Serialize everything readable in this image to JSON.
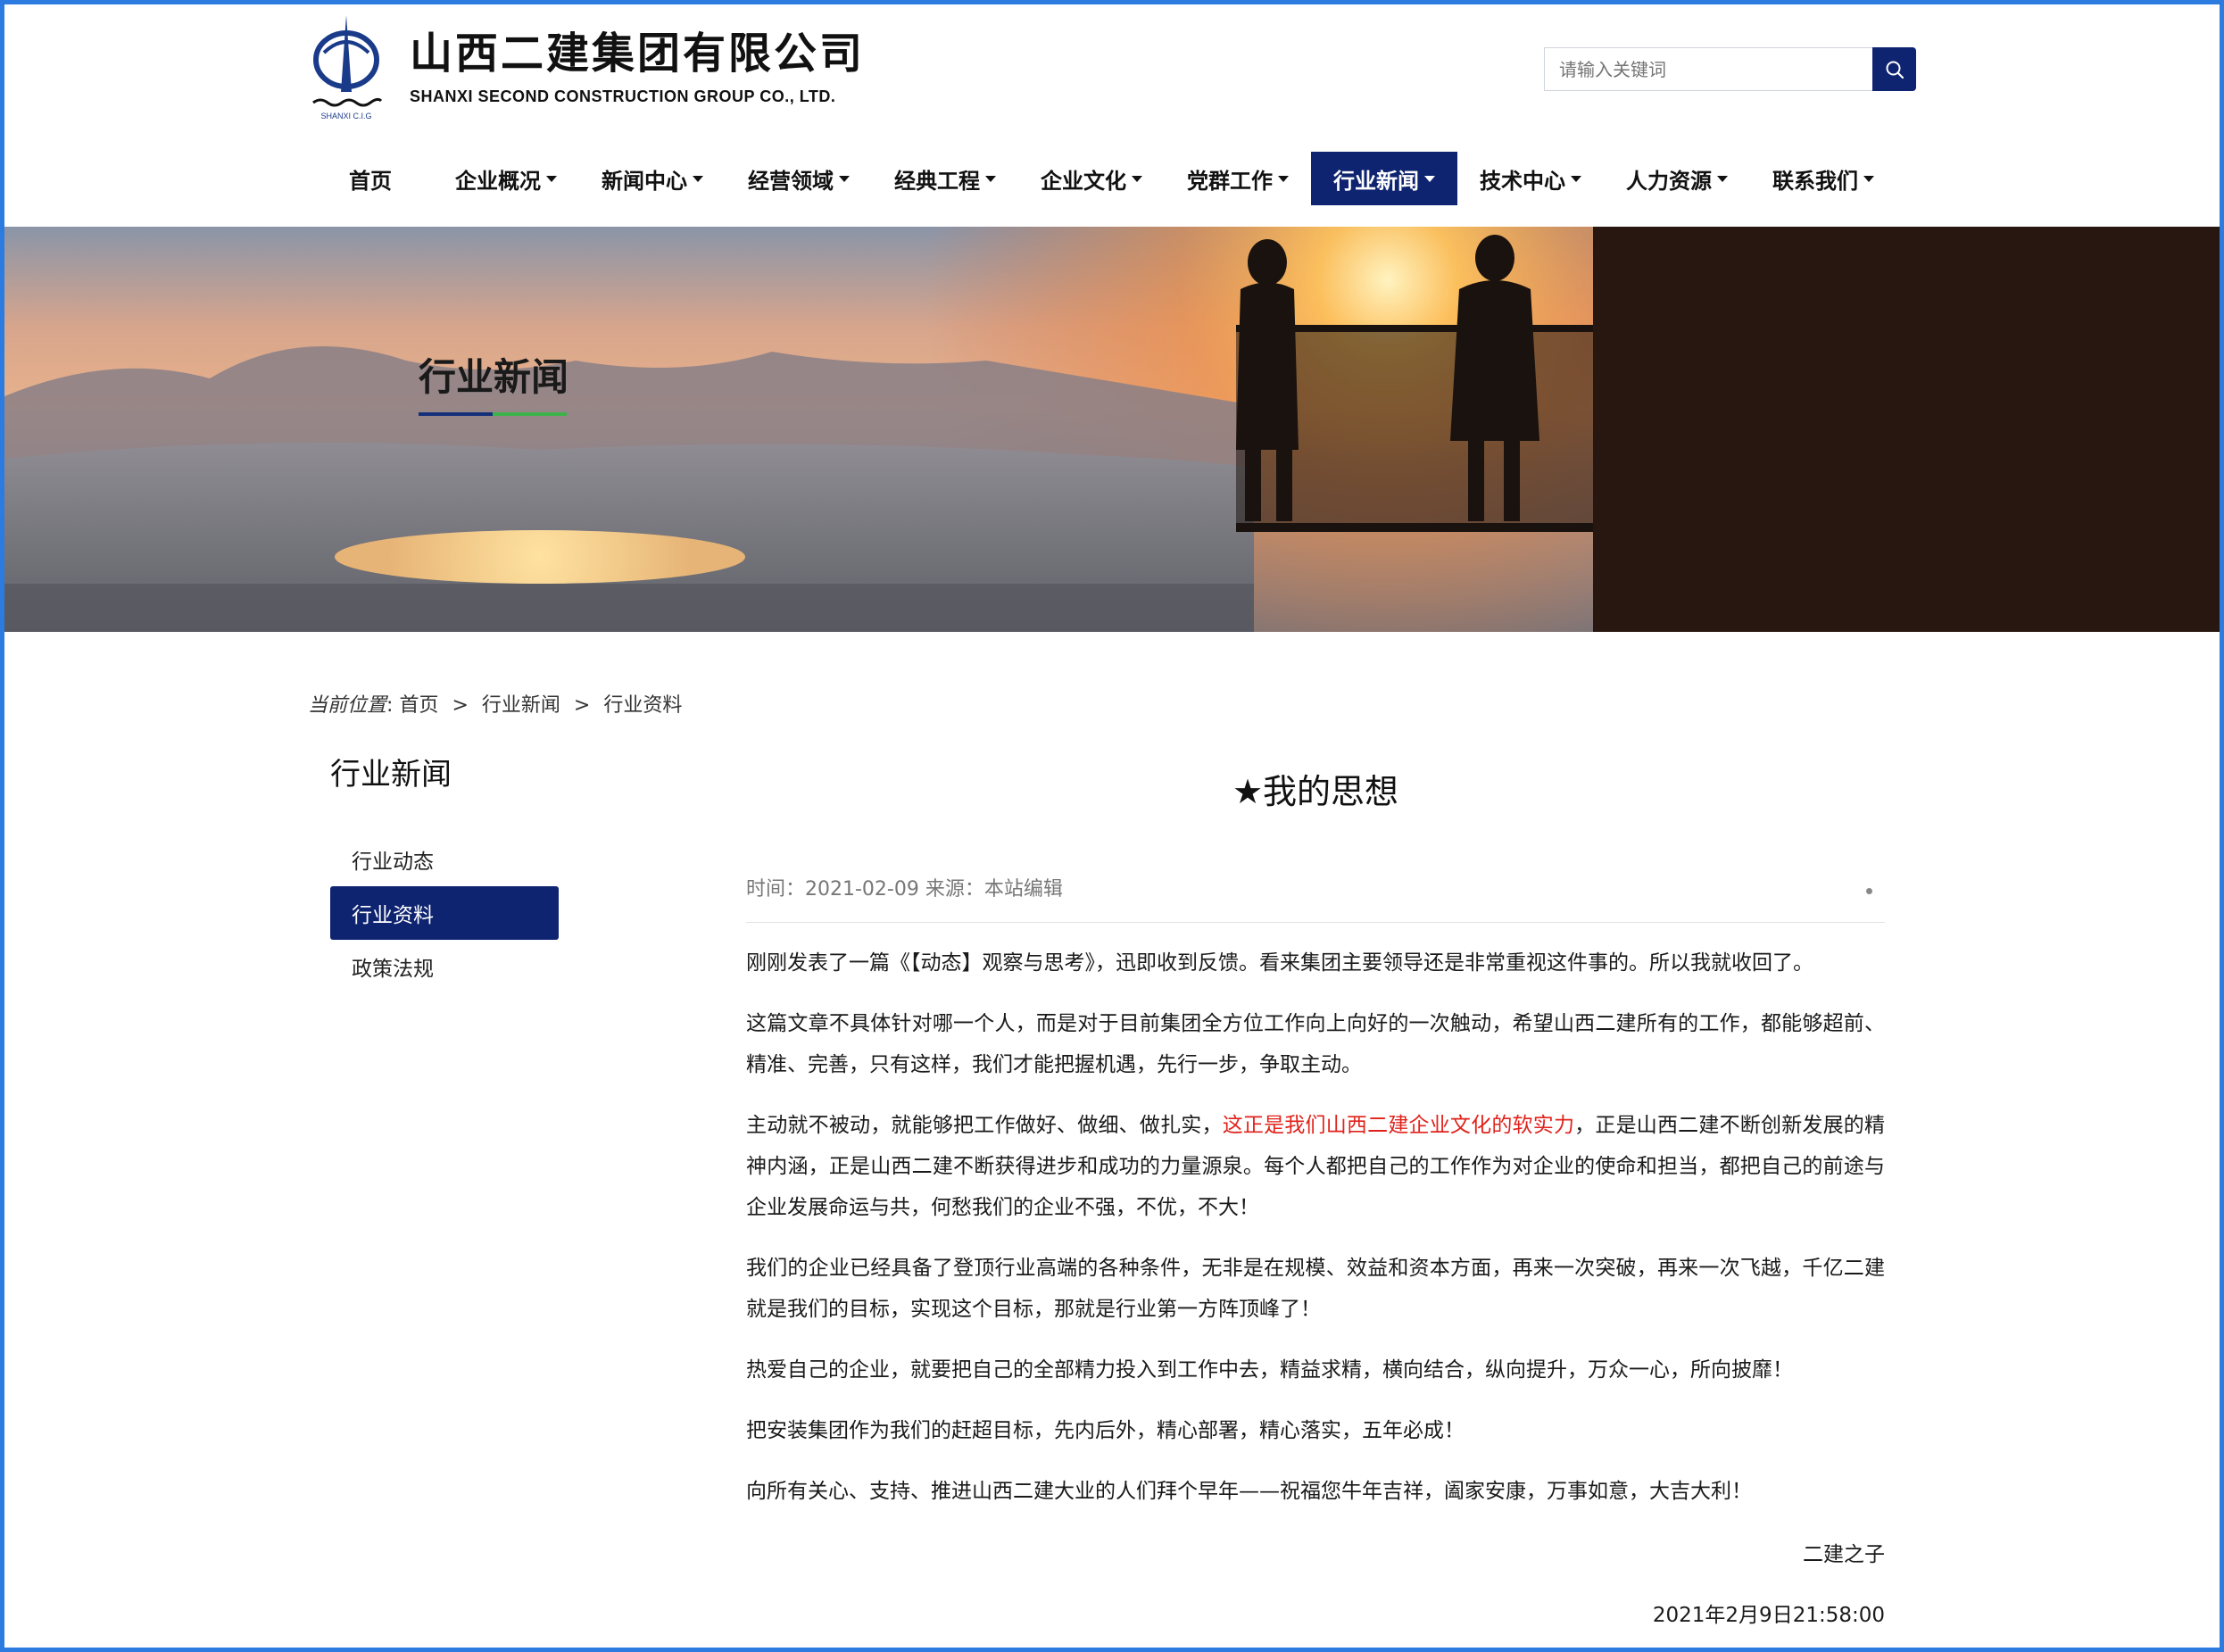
{
  "header": {
    "company_cn": "山西二建集团有限公司",
    "company_en": "SHANXI SECOND CONSTRUCTION GROUP CO., LTD.",
    "logo_small_text": "SHANXI C.I.G",
    "search_placeholder": "请输入关键词"
  },
  "nav": [
    {
      "label": "首页",
      "has_menu": false,
      "active": false
    },
    {
      "label": "企业概况",
      "has_menu": true,
      "active": false
    },
    {
      "label": "新闻中心",
      "has_menu": true,
      "active": false
    },
    {
      "label": "经营领域",
      "has_menu": true,
      "active": false
    },
    {
      "label": "经典工程",
      "has_menu": true,
      "active": false
    },
    {
      "label": "企业文化",
      "has_menu": true,
      "active": false
    },
    {
      "label": "党群工作",
      "has_menu": true,
      "active": false
    },
    {
      "label": "行业新闻",
      "has_menu": true,
      "active": true
    },
    {
      "label": "技术中心",
      "has_menu": true,
      "active": false
    },
    {
      "label": "人力资源",
      "has_menu": true,
      "active": false
    },
    {
      "label": "联系我们",
      "has_menu": true,
      "active": false
    }
  ],
  "banner": {
    "title": "行业新闻"
  },
  "breadcrumb": {
    "lead": "当前位置",
    "colon": ":",
    "items": [
      "首页",
      "行业新闻",
      "行业资料"
    ],
    "separator": ">"
  },
  "sidebar": {
    "title": "行业新闻",
    "items": [
      {
        "label": "行业动态",
        "active": false
      },
      {
        "label": "行业资料",
        "active": true
      },
      {
        "label": "政策法规",
        "active": false
      }
    ]
  },
  "article": {
    "title": "★我的思想",
    "meta": "时间：2021-02-09 来源：本站编辑",
    "paragraphs": [
      {
        "text": "刚刚发表了一篇《【动态】观察与思考》，迅即收到反馈。看来集团主要领导还是非常重视这件事的。所以我就收回了。"
      },
      {
        "text": "这篇文章不具体针对哪一个人，而是对于目前集团全方位工作向上向好的一次触动，希望山西二建所有的工作，都能够超前、精准、完善，只有这样，我们才能把握机遇，先行一步，争取主动。"
      },
      {
        "before": "主动就不被动，就能够把工作做好、做细、做扎实，",
        "highlight": "这正是我们山西二建企业文化的软实力",
        "after": "，正是山西二建不断创新发展的精神内涵，正是山西二建不断获得进步和成功的力量源泉。每个人都把自己的工作作为对企业的使命和担当，都把自己的前途与企业发展命运与共，何愁我们的企业不强，不优，不大！"
      },
      {
        "text": "我们的企业已经具备了登顶行业高端的各种条件，无非是在规模、效益和资本方面，再来一次突破，再来一次飞越，千亿二建就是我们的目标，实现这个目标，那就是行业第一方阵顶峰了！"
      },
      {
        "text": "热爱自己的企业，就要把自己的全部精力投入到工作中去，精益求精，横向结合，纵向提升，万众一心，所向披靡！"
      },
      {
        "text": "把安装集团作为我们的赶超目标，先内后外，精心部署，精心落实，五年必成！"
      },
      {
        "text": "向所有关心、支持、推进山西二建大业的人们拜个早年——祝福您牛年吉祥，阖家安康，万事如意，大吉大利！"
      }
    ],
    "signature": "二建之子",
    "signed_at": "2021年2月9日21:58:00",
    "highlight_color": "#e0221b"
  },
  "colors": {
    "brand": "#0f2470",
    "accent_green": "#3bb34a",
    "frame": "#2b7be0"
  }
}
